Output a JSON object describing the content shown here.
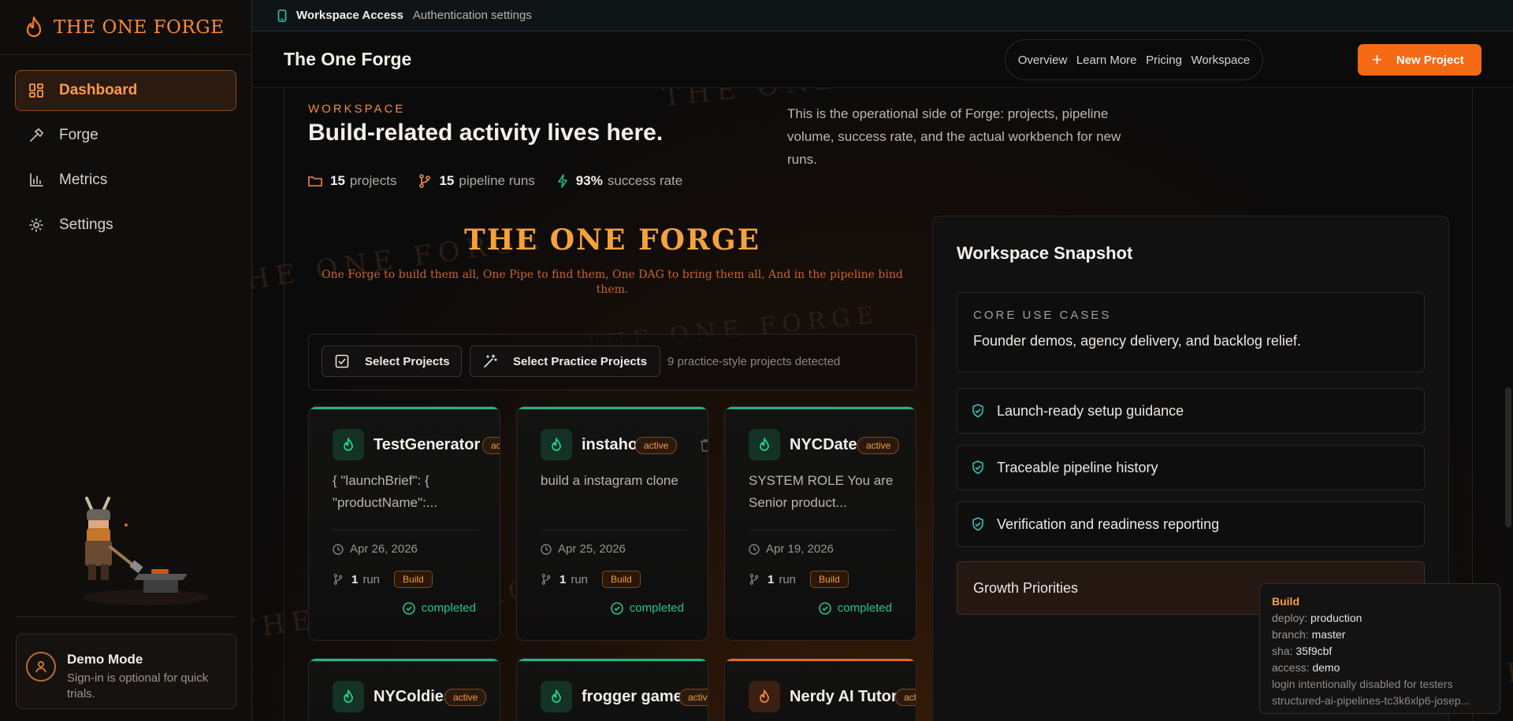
{
  "sidebar": {
    "brand": "THE ONE FORGE",
    "items": [
      {
        "label": "Dashboard",
        "icon": "dashboard-icon"
      },
      {
        "label": "Forge",
        "icon": "hammer-icon"
      },
      {
        "label": "Metrics",
        "icon": "bar-chart-icon"
      },
      {
        "label": "Settings",
        "icon": "gear-icon"
      }
    ],
    "demo": {
      "title": "Demo Mode",
      "subtitle": "Sign-in is optional for quick trials."
    }
  },
  "topstrip": {
    "title": "Workspace Access",
    "subtitle": "Authentication settings"
  },
  "header": {
    "title": "The One Forge",
    "nav": [
      "Overview",
      "Learn More",
      "Pricing",
      "Workspace"
    ],
    "new_project": "New Project"
  },
  "workspace": {
    "eyebrow": "WORKSPACE",
    "title": "Build-related activity lives here.",
    "description": "This is the operational side of Forge: projects, pipeline volume, success rate, and the actual workbench for new runs.",
    "stats": [
      {
        "value": "15",
        "label": "projects"
      },
      {
        "value": "15",
        "label": "pipeline runs"
      },
      {
        "value": "93%",
        "label": "success rate"
      }
    ]
  },
  "hero": {
    "title": "THE ONE FORGE",
    "tagline": "One Forge to build them all, One Pipe to find them, One DAG to bring them all, And in the pipeline bind them.",
    "watermark": "THE ONE FORGE"
  },
  "selection": {
    "select_projects": "Select Projects",
    "select_practice": "Select Practice Projects",
    "detected": "9 practice-style projects detected"
  },
  "projects": [
    {
      "name": "TestGenerator",
      "badge": "active",
      "description": "{ \"launchBrief\": { \"productName\":...",
      "date": "Apr 26, 2026",
      "runs": "1",
      "run_label": "run",
      "tag": "Build",
      "status": "completed"
    },
    {
      "name": "instaho",
      "badge": "active",
      "description": "build a instagram clone",
      "date": "Apr 25, 2026",
      "runs": "1",
      "run_label": "run",
      "tag": "Build",
      "status": "completed"
    },
    {
      "name": "NYCDate",
      "badge": "active",
      "description": "SYSTEM ROLE You are Senior product...",
      "date": "Apr 19, 2026",
      "runs": "1",
      "run_label": "run",
      "tag": "Build",
      "status": "completed"
    },
    {
      "name": "NYColdies",
      "badge": "active"
    },
    {
      "name": "frogger game",
      "badge": "active"
    },
    {
      "name": "Nerdy AI Tutor",
      "badge": "active"
    }
  ],
  "snapshot": {
    "title": "Workspace Snapshot",
    "core_eyebrow": "CORE USE CASES",
    "core_text": "Founder demos, agency delivery, and backlog relief.",
    "features": [
      "Launch-ready setup guidance",
      "Traceable pipeline history",
      "Verification and readiness reporting"
    ],
    "growth": "Growth Priorities"
  },
  "tooltip": {
    "heading": "Build",
    "deploy_key": "deploy:",
    "deploy": "production",
    "branch_key": "branch:",
    "branch": "master",
    "sha_key": "sha:",
    "sha": "35f9cbf",
    "access_key": "access:",
    "access": "demo",
    "note": "login intentionally disabled for testers",
    "host": "structured-ai-pipelines-tc3k6xlp6-josep..."
  },
  "colors": {
    "accent": "#f46a14",
    "success": "#22c58f",
    "brand": "#ff8a2b"
  }
}
